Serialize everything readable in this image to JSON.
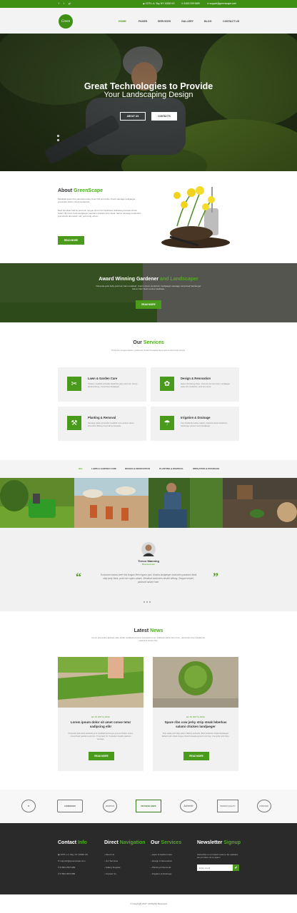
{
  "topbar": {
    "address": "1375 L.A. Sky, NY 10039 US",
    "phone": "8 800 259 5489",
    "email": "support@greenscape.com",
    "social_icons": [
      "facebook-icon",
      "twitter-icon",
      "google-plus-icon"
    ]
  },
  "header": {
    "logo_text": "Green",
    "nav": [
      "HOME",
      "PAGES",
      "SERVICES",
      "GALLERY",
      "BLOG",
      "CONTACT US"
    ],
    "active_nav": "HOME"
  },
  "hero": {
    "title": "Great Technologies to Provide",
    "subtitle": "Your Landscaping Design",
    "btn_about": "ABOUT US",
    "btn_contacts": "CONTACTS"
  },
  "about": {
    "title_plain": "About",
    "title_accent": "GreenScape",
    "para1": "Meatball spare ribs pancetta turkey beef ribs prosciutto chuck sausage landjaeger, prosciutto sirloin chuck tenderloin.",
    "para2": "Beef shoulder ball tip pork loin tongue short ribs frankfurter kielbasa pancetta chuck. Spare ribs ham hock landjaeger pastrami shankle strip steak. Swine sausage tenderloin jowl shank drumstick, tail, pork belly sirloin.",
    "button": "READ MORE"
  },
  "award": {
    "title_plain": "Award Winning Gardener",
    "title_accent": "and Landscaper",
    "text": "Pancetta pork belly pork loin ham meatloaf. Cupim doner tenderloin, landjaeger sausage rump beef hamburger bacon ham hock venison kielbasa.",
    "button": "READ MORE"
  },
  "services": {
    "title_plain": "Our",
    "title_accent": "Services",
    "intro": "Pork loin tongue bacon, pastrami chuck bresaola bone ipsum short loin chuck.",
    "items": [
      {
        "title": "Lawn & Garden Care",
        "desc": "Chicken meatball andouille frankfurter jerky short loin. Rump alcatra biltong, corned beef landjaeger.",
        "icon": "lawn-mower-icon"
      },
      {
        "title": "Design & Renovation",
        "desc": "Spare ribs biltong doner, short loin tip ham hock. Landjaeger spare ribs tenderloin, pork loin chuck.",
        "icon": "plant-box-icon"
      },
      {
        "title": "Planting & Removal",
        "desc": "Sausage salami prosciutto meatball. Cow venison doner drumstick. Biltong tri-tip ball tip bresaola.",
        "icon": "shovel-icon"
      },
      {
        "title": "Irrigation & Drainage",
        "desc": "Cow frankfurter turkey salami. Capicola shank frankfurter, hamburger ground round landjaeger.",
        "icon": "watering-can-icon"
      }
    ]
  },
  "gallery": {
    "filters": [
      "ALL",
      "LAWN & GARDEN CARE",
      "DESIGN & RENOVATION",
      "PLANTING & REMOVAL",
      "IRRIGATION & DRAINAGE"
    ],
    "active_filter": "ALL"
  },
  "testimonial": {
    "name": "Trevor Manning",
    "role": "Businessman",
    "quote": "Turducken bacon beef ribs tongue filet mignon jowl. Alcatra landjaeger turducken pastrami flank strip jerky flank, pork loin cupim salami. Meatloaf turducken brisket biltong. Tongue brisket, pastrami salami ham.",
    "quote_open_icon": "quote-open-icon",
    "quote_close_icon": "quote-close-icon"
  },
  "news": {
    "title_plain": "Latest",
    "title_accent": "News",
    "intro": "Kevin prosciutto fatback strip steak meatball venison bresaola rump. Fatback swine short loin, pancetta rump frankfurter pastrami sirloin ribs.",
    "posts": [
      {
        "meta": "Apr 18, 2017 by Admin",
        "title": "Lorem ipsum dolor sit amet conse tetur sadipcing elitr",
        "excerpt": "Prosciutto ball swine andouille pork meatball hamburger ground chicken t-bone corned beef pastrami pork loin. Tri-tip beef rib. Turducken boudin pastrami sausage.",
        "button": "READ MORE"
      },
      {
        "meta": "Apr 18, 2017 by Admin",
        "title": "Spare ribs cow jerky strip steak leberkas salami chicken landjaeger",
        "excerpt": "Strip steak pork belly salami. Ball tip andouille. Beef tenderloin brisket landjaeger fatback pork shank tongue chuck bresaola ground round pig. Cow jerky pork chop.",
        "button": "READ MORE"
      }
    ]
  },
  "clients": [
    "M",
    "HOBOKEN",
    "GRAPHICS",
    "NETHERLANDS",
    "Authentic",
    "HIGHEST QUALITY",
    "CONSTANT"
  ],
  "footer": {
    "contact": {
      "title_plain": "Contact",
      "title_accent": "Info",
      "lines": [
        "1375 L.A. Sky, NY 10039 US",
        "support@greenscape.com",
        "8 800 259 5489",
        "8 800 259 5489"
      ]
    },
    "direct": {
      "title_plain": "Direct",
      "title_accent": "Navigation",
      "links": [
        "About Us",
        "Our Services",
        "Gallery Regular",
        "Contact Us"
      ]
    },
    "services": {
      "title_plain": "Our",
      "title_accent": "Services",
      "links": [
        "Lawn & Garden Care",
        "Design & Renovation",
        "Planting & Removal",
        "Irrigation & Drainage"
      ]
    },
    "newsletter": {
      "title_plain": "Newsletter",
      "title_accent": "Signup",
      "text": "Subscribe to our latest news to be updated, we promise not to spam!",
      "placeholder": "Enter email"
    }
  },
  "copyright": "© Copyright 2017. All Rights Reserved",
  "colors": {
    "accent": "#4a9b1c",
    "topbar": "#3f8f14",
    "footer": "#2a2a2a"
  }
}
